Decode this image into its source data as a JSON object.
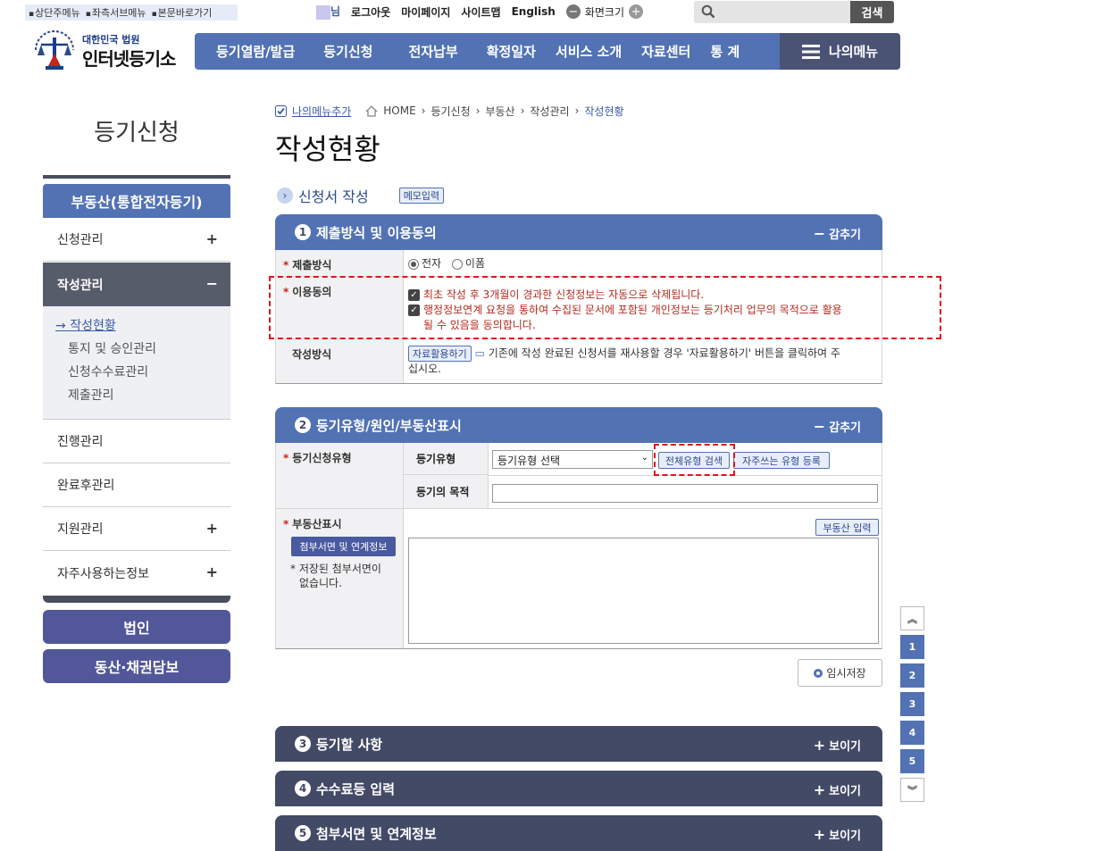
{
  "skip_links": [
    "상단주메뉴",
    "좌측서브메뉴",
    "본문바로가기"
  ],
  "util": {
    "user_suffix": "님",
    "logout": "로그아웃",
    "mypage": "마이페이지",
    "sitemap": "사이트맵",
    "english": "English",
    "zoom_label": "화면크기",
    "zoom_out": "−",
    "zoom_in": "+"
  },
  "search": {
    "placeholder": "",
    "button": "검색"
  },
  "logo": {
    "line1": "대한민국 법원",
    "line2": "인터넷등기소"
  },
  "gnb": [
    "등기열람/발급",
    "등기신청",
    "전자납부",
    "확정일자",
    "서비스 소개",
    "자료센터",
    "통 계"
  ],
  "my_menu": "나의메뉴",
  "lnb": {
    "title": "등기신청",
    "head": "부동산(통합전자등기)",
    "items": [
      {
        "label": "신청관리",
        "pm": "+"
      },
      {
        "label": "작성관리",
        "pm": "−"
      },
      {
        "label": "진행관리",
        "pm": ""
      },
      {
        "label": "완료후관리",
        "pm": ""
      },
      {
        "label": "지원관리",
        "pm": "+"
      },
      {
        "label": "자주사용하는정보",
        "pm": "+"
      }
    ],
    "sub": [
      "작성현황",
      "통지 및 승인관리",
      "신청수수료관리",
      "제출관리"
    ],
    "btn_corp": "법인",
    "btn_movable": "동산·채권담보"
  },
  "breadcrumb": {
    "mymenu_add": "나의메뉴추가",
    "home": "HOME",
    "items": [
      "등기신청",
      "부동산",
      "작성관리"
    ],
    "current": "작성현황"
  },
  "page_title": "작성현황",
  "section": {
    "title": "신청서 작성",
    "memo_button": "메모입력"
  },
  "panel1": {
    "num": "1",
    "title": "제출방식 및 이용동의",
    "toggle": "감추기",
    "submit_label": "제출방식",
    "submit_opts": [
      "전자",
      "이폼"
    ],
    "consent_label": "이용동의",
    "consent1": "최초 작성 후 3개월이 경과한 신청정보는 자동으로 삭제됩니다.",
    "consent2a": "행정정보연계 요청을 통하여 수집된 문서에 포함된 개인정보는 등기처리 업무의 목적으로 활용",
    "consent2b": "될 수 있음을 동의합니다.",
    "method_label": "작성방식",
    "method_button": "자료활용하기",
    "method_text_a": "기존에 작성 완료된 신청서를 재사용할 경우 '자료활용하기' 버튼을 클릭하여 주",
    "method_text_b": "십시오."
  },
  "panel2": {
    "num": "2",
    "title": "등기유형/원인/부동산표시",
    "toggle": "감추기",
    "type_label": "등기신청유형",
    "type_sub": "등기유형",
    "type_select": "등기유형 선택",
    "btn_all": "전체유형 검색",
    "btn_fav": "자주쓰는 유형 등록",
    "purpose_label": "등기의 목적",
    "prop_label": "부동산표시",
    "prop_btn": "첨부서면 및 연계정보",
    "prop_note_a": "저장된 첨부서면이",
    "prop_note_b": "없습니다.",
    "prop_input_btn": "부동산 입력"
  },
  "temp_save": "임시저장",
  "collapsed_panels": [
    {
      "num": "3",
      "title": "등기할 사항",
      "toggle": "보이기"
    },
    {
      "num": "4",
      "title": "수수료등 입력",
      "toggle": "보이기"
    },
    {
      "num": "5",
      "title": "첨부서면 및 연계정보",
      "toggle": "보이기"
    }
  ],
  "side_nav": [
    "1",
    "2",
    "3",
    "4",
    "5"
  ],
  "colors": {
    "primary": "#5272b4",
    "dark": "#434a66",
    "required": "#c5261b",
    "highlight": "#e0141c"
  }
}
